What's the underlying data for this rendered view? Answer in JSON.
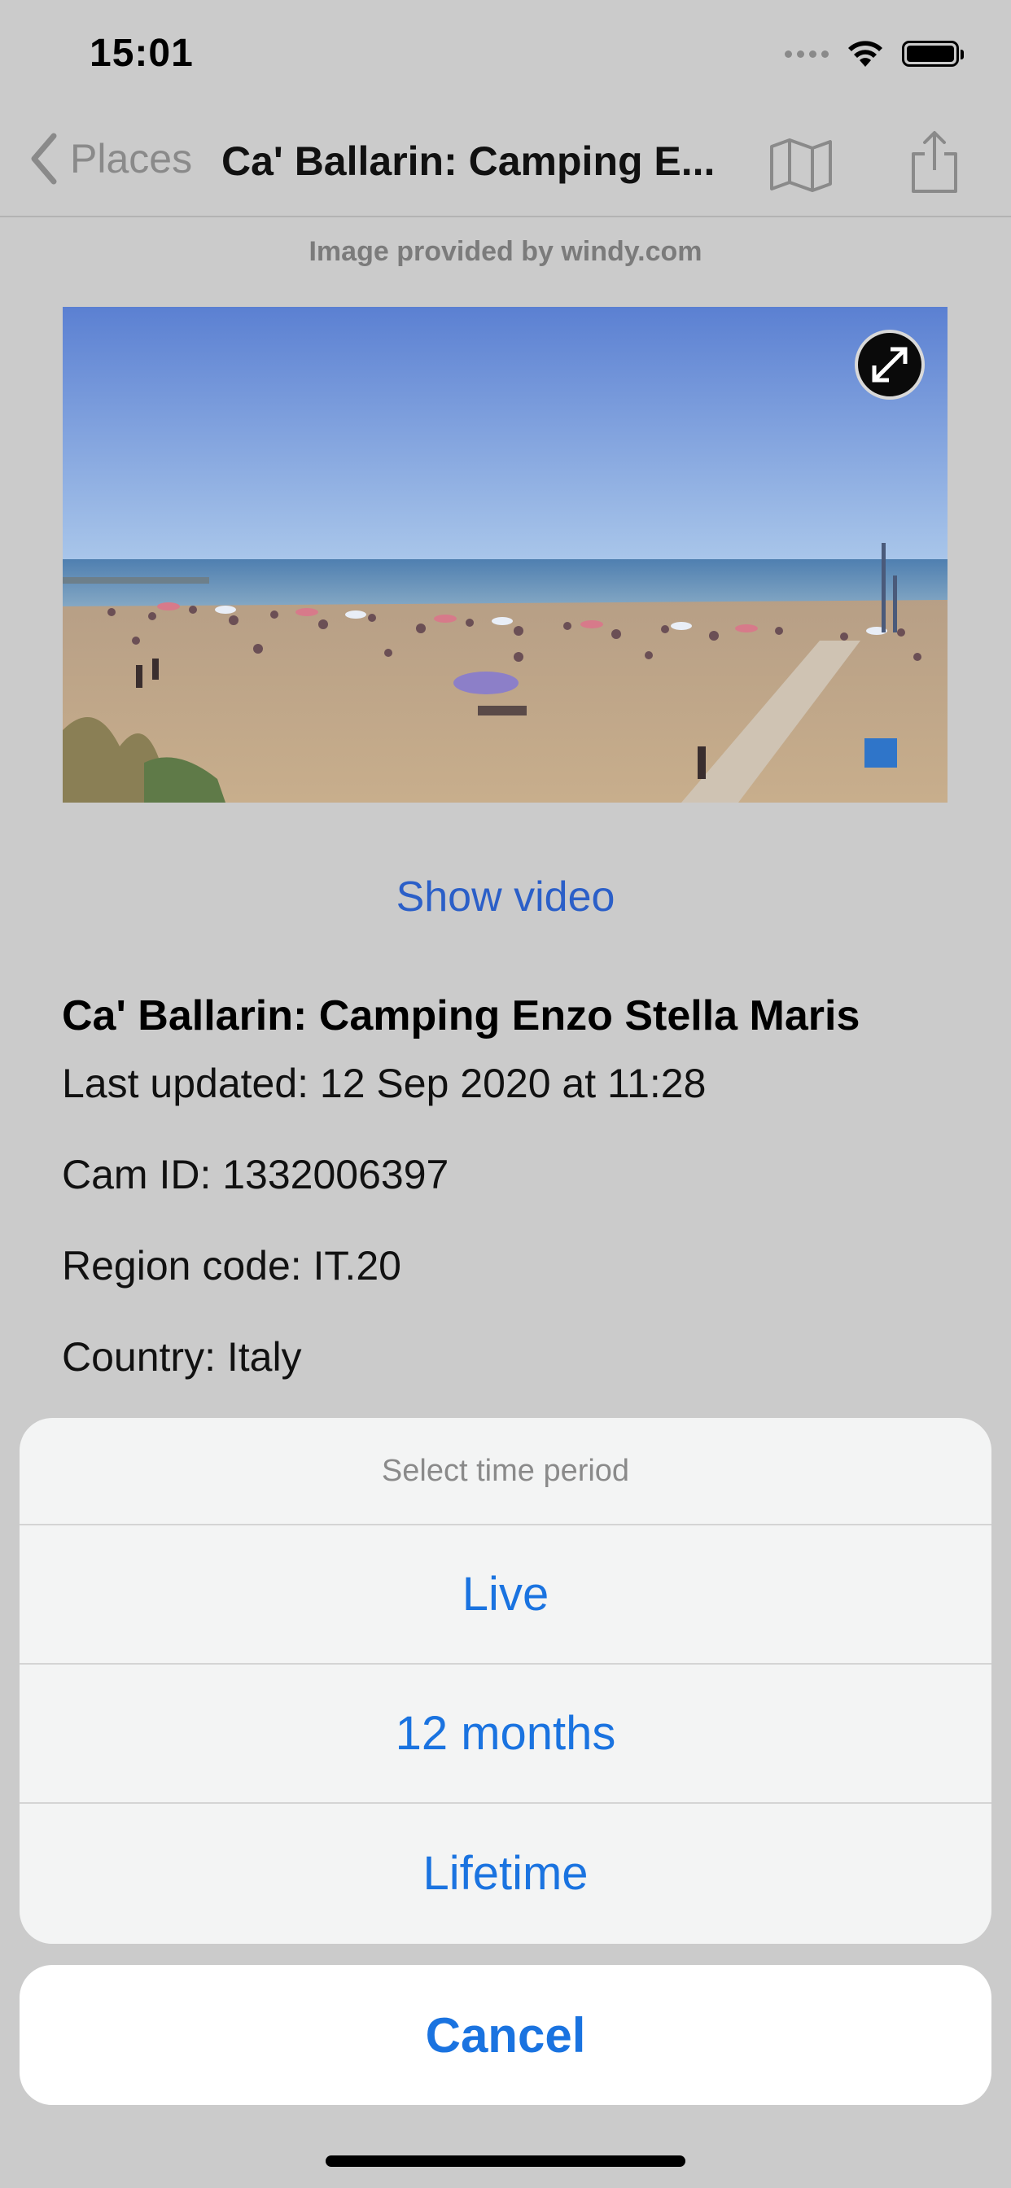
{
  "status_bar": {
    "time": "15:01"
  },
  "nav": {
    "back_label": "Places",
    "title": "Ca' Ballarin: Camping E...",
    "map_icon": "map-icon",
    "share_icon": "share-icon"
  },
  "attribution": "Image provided by windy.com",
  "webcam": {
    "expand_icon": "expand-arrows-icon"
  },
  "show_video": "Show video",
  "details": {
    "title": "Ca' Ballarin: Camping Enzo Stella Maris",
    "last_updated": "Last updated: 12 Sep 2020 at 11:28",
    "cam_id": "Cam ID: 1332006397",
    "region_code": "Region code: IT.20",
    "country": "Country: Italy"
  },
  "action_sheet": {
    "header": "Select time period",
    "options": [
      "Live",
      "12 months",
      "Lifetime"
    ],
    "cancel": "Cancel"
  },
  "colors": {
    "accent": "#1a73e0",
    "link": "#2b5fc8",
    "background": "#cbcbcb"
  }
}
